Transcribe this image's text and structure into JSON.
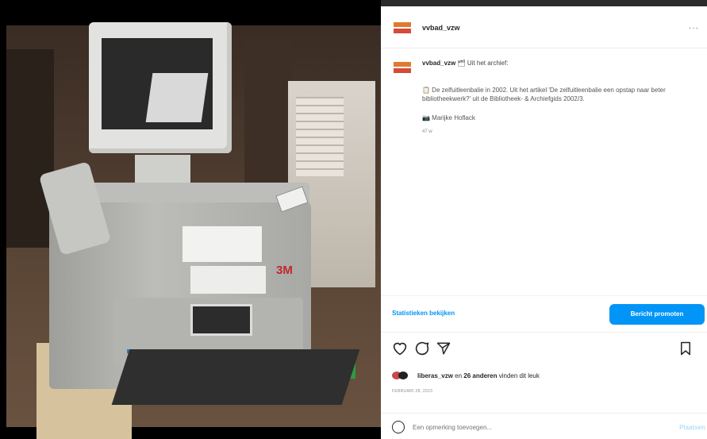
{
  "post": {
    "username": "vvbad_vzw",
    "more": "···"
  },
  "caption": {
    "username": "vvbad_vzw",
    "header_suffix": "🗂 Uit het archief:",
    "body": "📋 De zelfuitleenbalie in 2002. Uit het artikel 'De zelfuitleenbalie een opstap naar beter bibliotheekwerk?' uit de Bibliotheek- & Archiefgids 2002/3.",
    "credit": "📷 Marijke Hoflack",
    "age": "47 w"
  },
  "promo": {
    "stats_link": "Statistieken bekijken",
    "promote_button": "Bericht promoten"
  },
  "likes": {
    "first_user": "liberas_vzw",
    "connector": " en ",
    "others": "26 anderen",
    "suffix": " vinden dit leuk"
  },
  "date": "FEBRUARI 28, 2023",
  "comment": {
    "placeholder": "Een opmerking toevoegen...",
    "post_label": "Plaatsen"
  },
  "icons": [
    "heart-icon",
    "comment-icon",
    "share-icon",
    "bookmark-icon",
    "emoji-icon",
    "more-icon"
  ],
  "colors": {
    "accent": "#0095f6",
    "text": "#262626",
    "muted": "#8e8e8e"
  }
}
